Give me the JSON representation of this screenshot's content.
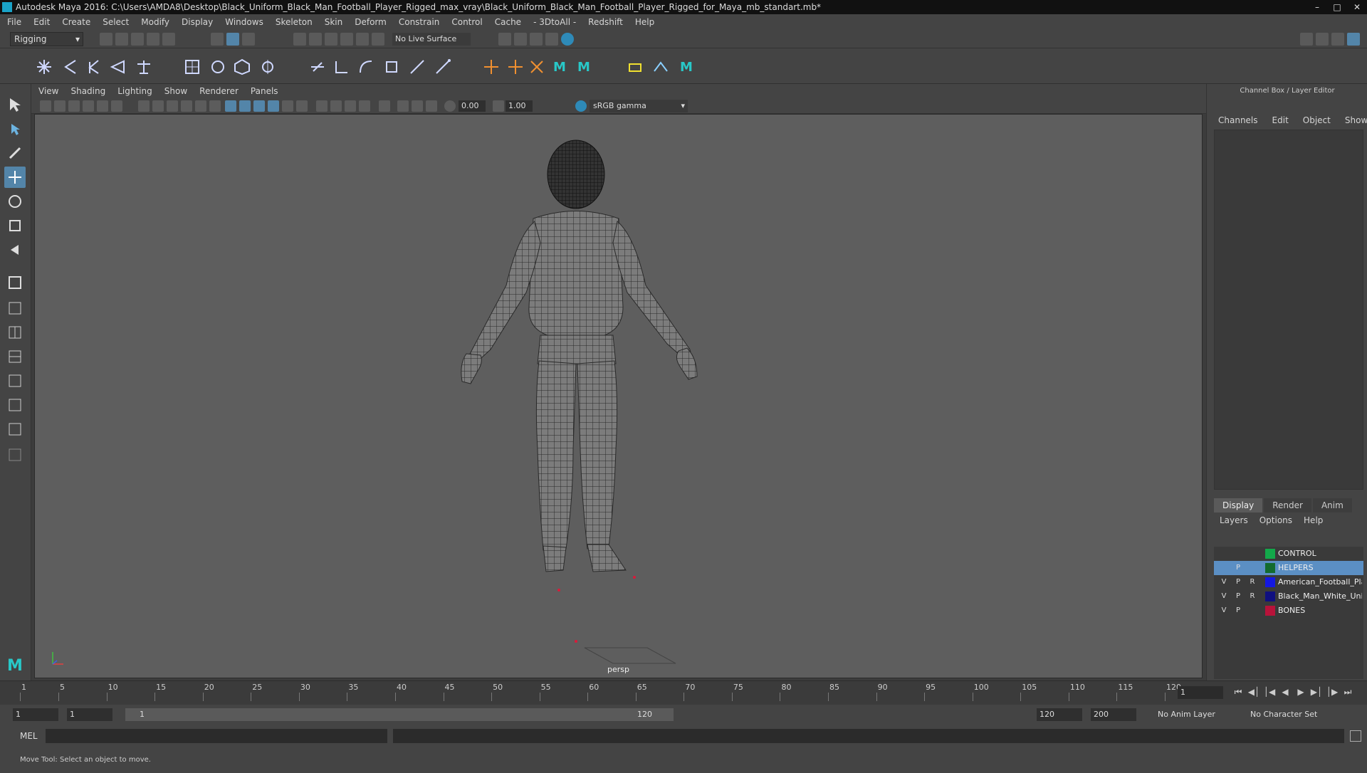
{
  "window": {
    "title": "Autodesk Maya 2016: C:\\Users\\AMDA8\\Desktop\\Black_Uniform_Black_Man_Football_Player_Rigged_max_vray\\Black_Uniform_Black_Man_Football_Player_Rigged_for_Maya_mb_standart.mb*"
  },
  "menu": [
    "File",
    "Edit",
    "Create",
    "Select",
    "Modify",
    "Display",
    "Windows",
    "Skeleton",
    "Skin",
    "Deform",
    "Constrain",
    "Control",
    "Cache",
    "- 3DtoAll -",
    "Redshift",
    "Help"
  ],
  "statusline": {
    "mode": "Rigging",
    "live_surface": "No Live Surface"
  },
  "panel_menu": [
    "View",
    "Shading",
    "Lighting",
    "Show",
    "Renderer",
    "Panels"
  ],
  "panel_bar": {
    "near": "0.00",
    "far": "1.00",
    "color_space": "sRGB gamma"
  },
  "viewport": {
    "camera": "persp"
  },
  "channel_box": {
    "title": "Channel Box / Layer Editor",
    "menu": [
      "Channels",
      "Edit",
      "Object",
      "Show"
    ]
  },
  "layer_editor": {
    "tabs": [
      "Display",
      "Render",
      "Anim"
    ],
    "menu": [
      "Layers",
      "Options",
      "Help"
    ],
    "layers": [
      {
        "v": "",
        "p": "",
        "r": "",
        "name": "CONTROL",
        "color": "#13a84a"
      },
      {
        "v": "",
        "p": "P",
        "r": "",
        "name": "HELPERS",
        "color": "#136b2e"
      },
      {
        "v": "V",
        "p": "P",
        "r": "R",
        "name": "American_Football_Pla",
        "color": "#1418e0"
      },
      {
        "v": "V",
        "p": "P",
        "r": "R",
        "name": "Black_Man_White_Uniform_T",
        "color": "#101080"
      },
      {
        "v": "V",
        "p": "P",
        "r": "",
        "name": "BONES",
        "color": "#b8133a"
      }
    ]
  },
  "timeline": {
    "ticks": [
      "1",
      "5",
      "10",
      "15",
      "20",
      "25",
      "30",
      "35",
      "40",
      "45",
      "50",
      "55",
      "60",
      "65",
      "70",
      "75",
      "80",
      "85",
      "90",
      "95",
      "100",
      "105",
      "110",
      "115",
      "120"
    ],
    "current_frame": "1"
  },
  "range": {
    "start": "1",
    "playback_start": "1",
    "slider_start": "1",
    "slider_end": "120",
    "playback_end": "120",
    "end": "200",
    "anim_layer": "No Anim Layer",
    "char_set": "No Character Set"
  },
  "cmdline": {
    "lang": "MEL"
  },
  "help": "Move Tool: Select an object to move."
}
